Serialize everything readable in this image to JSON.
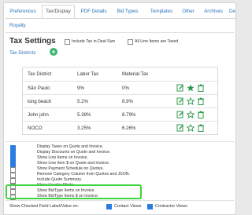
{
  "tabs": [
    {
      "label": "Preferences",
      "active": false
    },
    {
      "label": "Tax/Display",
      "active": true
    },
    {
      "label": "PDF Details",
      "active": false
    },
    {
      "label": "Bid Types",
      "active": false
    },
    {
      "label": "Templates",
      "active": false
    },
    {
      "label": "Other",
      "active": false
    },
    {
      "label": "Archives",
      "active": false
    },
    {
      "label": "De",
      "active": false
    }
  ],
  "royalty_label": "Royalty",
  "tax_settings": {
    "title": "Tax Settings",
    "include_tax_label": "Include Tax in Deal Size",
    "include_tax_checked": false,
    "all_line_items_label": "All Line Items are Taxed",
    "all_line_items_checked": false,
    "tax_districts_link": "Tax Districts",
    "add_symbol": "+"
  },
  "table": {
    "headers": [
      "Tax District",
      "Labor Tax",
      "Material Tax"
    ],
    "rows": [
      {
        "district": "São Paulo",
        "labor": "9%",
        "material": "0%",
        "starred": true
      },
      {
        "district": "long beach",
        "labor": "5.2%",
        "material": "8.9%",
        "starred": false
      },
      {
        "district": "John john",
        "labor": "5.38%",
        "material": "8.79%",
        "starred": false
      },
      {
        "district": "NOCO",
        "labor": "3.25%",
        "material": "6.26%",
        "starred": false
      }
    ]
  },
  "options": [
    {
      "label": "Display Taxes on Quote and Invoice.",
      "checked": true
    },
    {
      "label": "Display Discounts on Quote and Invoice.",
      "checked": true
    },
    {
      "label": "Show Line Items on Invoice.",
      "checked": true
    },
    {
      "label": "Show Line Item $ on Quote and Invoice.",
      "checked": true
    },
    {
      "label": "Show Payment Schedule on Quotes.",
      "checked": false
    },
    {
      "label": "Remove Category Column from Quotes and JSON.",
      "checked": false
    },
    {
      "label": "Include Quote Summary.",
      "checked": false
    },
    {
      "label": "Show Header Photo",
      "checked": false
    },
    {
      "label": "Show BidType Items on Invoice.",
      "checked": false
    },
    {
      "label": "Show BidType Items $ on Invoice.",
      "checked": false
    }
  ],
  "show_checked": {
    "label": "Show Checked Field Label/Value on:",
    "contact_views_label": "Contact Views",
    "contact_views_checked": true,
    "contractor_views_label": "Contractor Views",
    "contractor_views_checked": true
  },
  "colors": {
    "link": "#2a73b8",
    "checkbox_on": "#2b7de0",
    "add_button": "#3cb371",
    "highlight": "#3ed43e",
    "action_icon": "#2e9a4a"
  }
}
